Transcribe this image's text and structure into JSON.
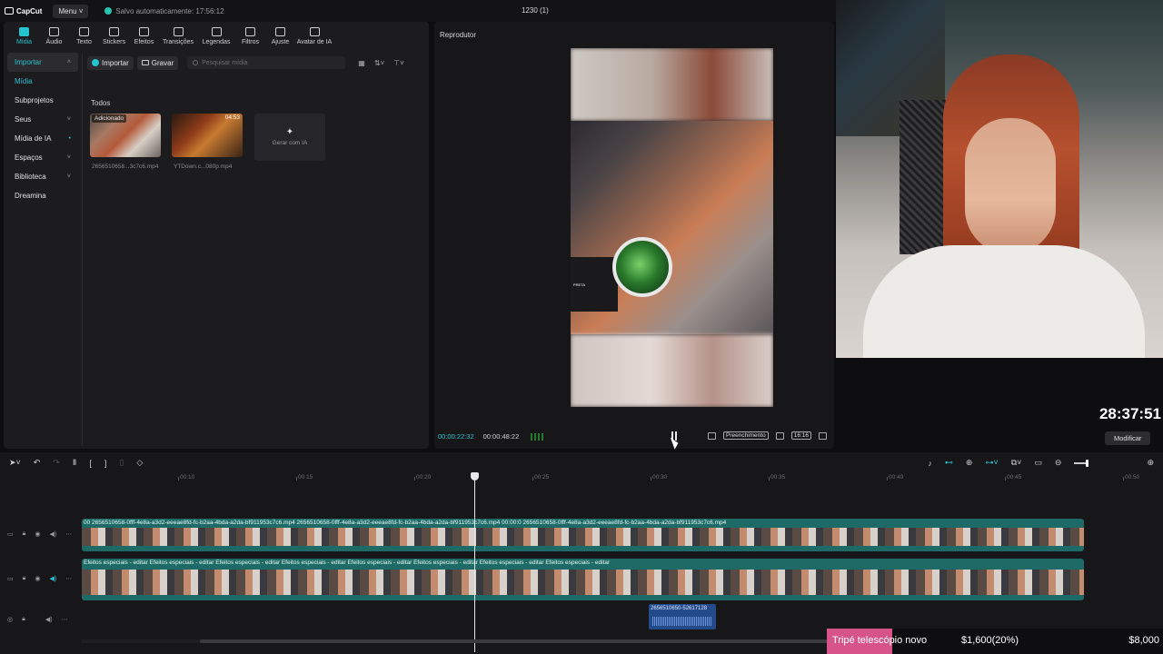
{
  "app": {
    "logo": "CapCut",
    "menu_label": "Menu",
    "saved_status": "Salvo automaticamente: 17:56:12",
    "project_title": "1230 (1)"
  },
  "tool_tabs": [
    {
      "label": "Mídia",
      "icon": "media-icon"
    },
    {
      "label": "Áudio",
      "icon": "audio-icon"
    },
    {
      "label": "Texto",
      "icon": "text-icon"
    },
    {
      "label": "Stickers",
      "icon": "sticker-icon"
    },
    {
      "label": "Efeitos",
      "icon": "effects-icon"
    },
    {
      "label": "Transições",
      "icon": "transitions-icon"
    },
    {
      "label": "Legendas",
      "icon": "captions-icon"
    },
    {
      "label": "Filtros",
      "icon": "filters-icon"
    },
    {
      "label": "Ajuste",
      "icon": "adjust-icon"
    },
    {
      "label": "Avatar de IA",
      "icon": "avatar-icon"
    }
  ],
  "side_nav": [
    {
      "label": "Importar",
      "chevron": "˄"
    },
    {
      "label": "Mídia",
      "chevron": ""
    },
    {
      "label": "Subprojetos",
      "chevron": ""
    },
    {
      "label": "Seus",
      "chevron": "˅"
    },
    {
      "label": "Mídia de IA",
      "chevron": ""
    },
    {
      "label": "Espaços",
      "chevron": "˅"
    },
    {
      "label": "Biblioteca",
      "chevron": "˅"
    },
    {
      "label": "Dreamina",
      "chevron": ""
    }
  ],
  "media_toolbar": {
    "import_label": "Importar",
    "record_label": "Gravar",
    "search_placeholder": "Pesquisar mídia"
  },
  "media": {
    "section": "Todos",
    "items": [
      {
        "name": "2656510658...3c7c6.mp4",
        "badge": "Adicionado"
      },
      {
        "name": "YTDown.c...080p.mp4",
        "duration": "04:53"
      }
    ],
    "generate_label": "Gerar com IA"
  },
  "player": {
    "title": "Reprodutor",
    "current_time": "00:00:22:32",
    "total_time": "00:00:48:22",
    "fill_label": "Preenchimento",
    "ratio_label": "16:16",
    "video_text": "PRETA"
  },
  "overlay": {
    "timer": "28:37:51",
    "modify_label": "Modificar"
  },
  "timeline": {
    "ticks": [
      "00:10",
      "00:15",
      "00:20",
      "00:25",
      "00:30",
      "00:35",
      "00:40",
      "00:45",
      "00:50"
    ],
    "track1_label": "00 2656510658-0fff-4e8a-a3d2-eeeae8fd-fc-b2aa-4bda-a2da-bf911953c7c6.mp4   2656510658-0fff-4e8a-a3d2-eeeae8fd-fc-b2aa-4bda-a2da-bf911953c7c6.mp4   00:00:0 2656510658-0fff-4e8a-a3d2-eeeae8fd-fc-b2aa-4bda-a2da-bf911953c7c6.mp4",
    "track2_label": "Efeitos especiais - editar   Efeitos especiais - editar   Efeitos especiais - editar   Efeitos especiais - editar   Efeitos especiais - editar   Efeitos especiais - editar   Efeitos especiais - editar   Efeitos especiais - editar",
    "audio_label": "2656510650-52617128"
  },
  "donation": {
    "label": "Tripé telescópio novo",
    "progress": "$1,600(20%)",
    "goal": "$8,000"
  },
  "colors": {
    "accent": "#27c2d0",
    "track": "#1e6a66",
    "donation_pink": "#d6548a"
  }
}
